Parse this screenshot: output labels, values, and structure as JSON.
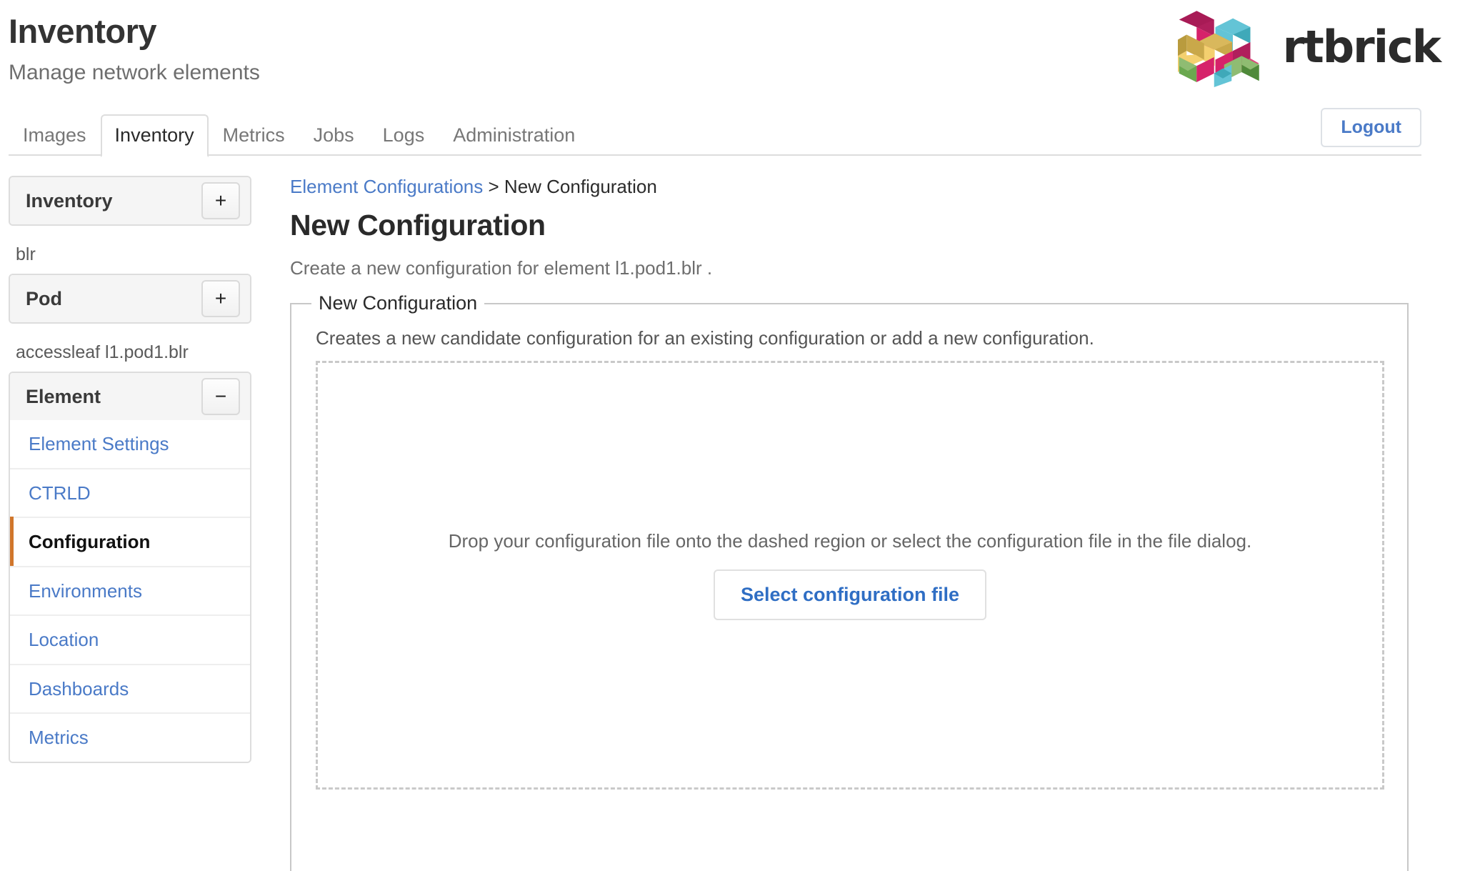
{
  "header": {
    "title": "Inventory",
    "subtitle": "Manage network elements",
    "brand_name": "rtbrick",
    "brand_colors": {
      "pink": "#d6226a",
      "magenta": "#e0487f",
      "teal": "#3fa9b9",
      "cyan": "#63c4d6",
      "gold": "#c9a84a",
      "yellow": "#f4d06f",
      "green": "#6aa84f",
      "light_green": "#8fbc72",
      "dark_pink": "#b01f5c",
      "word_color": "#2b2b2b"
    }
  },
  "tabs": [
    {
      "label": "Images",
      "active": false
    },
    {
      "label": "Inventory",
      "active": true
    },
    {
      "label": "Metrics",
      "active": false
    },
    {
      "label": "Jobs",
      "active": false
    },
    {
      "label": "Logs",
      "active": false
    },
    {
      "label": "Administration",
      "active": false
    }
  ],
  "logout": {
    "label": "Logout",
    "color": "#4a7ac7"
  },
  "sidebar": {
    "inventory_panel": {
      "title": "Inventory",
      "button": "+"
    },
    "pod_group_label": "blr",
    "pod_panel": {
      "title": "Pod",
      "button": "+"
    },
    "element_group_label": "accessleaf l1.pod1.blr",
    "element_panel": {
      "title": "Element",
      "button": "−"
    },
    "element_items": [
      {
        "label": "Element Settings",
        "active": false
      },
      {
        "label": "CTRLD",
        "active": false
      },
      {
        "label": "Configuration",
        "active": true
      },
      {
        "label": "Environments",
        "active": false
      },
      {
        "label": "Location",
        "active": false
      },
      {
        "label": "Dashboards",
        "active": false
      },
      {
        "label": "Metrics",
        "active": false
      }
    ],
    "active_indicator_color": "#d0762b"
  },
  "main": {
    "breadcrumb": {
      "link": "Element Configurations",
      "separator": ">",
      "current": "New Configuration"
    },
    "title": "New Configuration",
    "description": "Create a new configuration for element l1.pod1.blr .",
    "fieldset": {
      "legend": "New Configuration",
      "description": "Creates a new candidate configuration for an existing configuration or add a new configuration.",
      "dropzone_text": "Drop your configuration file onto the dashed region or select the configuration file in the file dialog.",
      "select_button": "Select configuration file"
    }
  }
}
